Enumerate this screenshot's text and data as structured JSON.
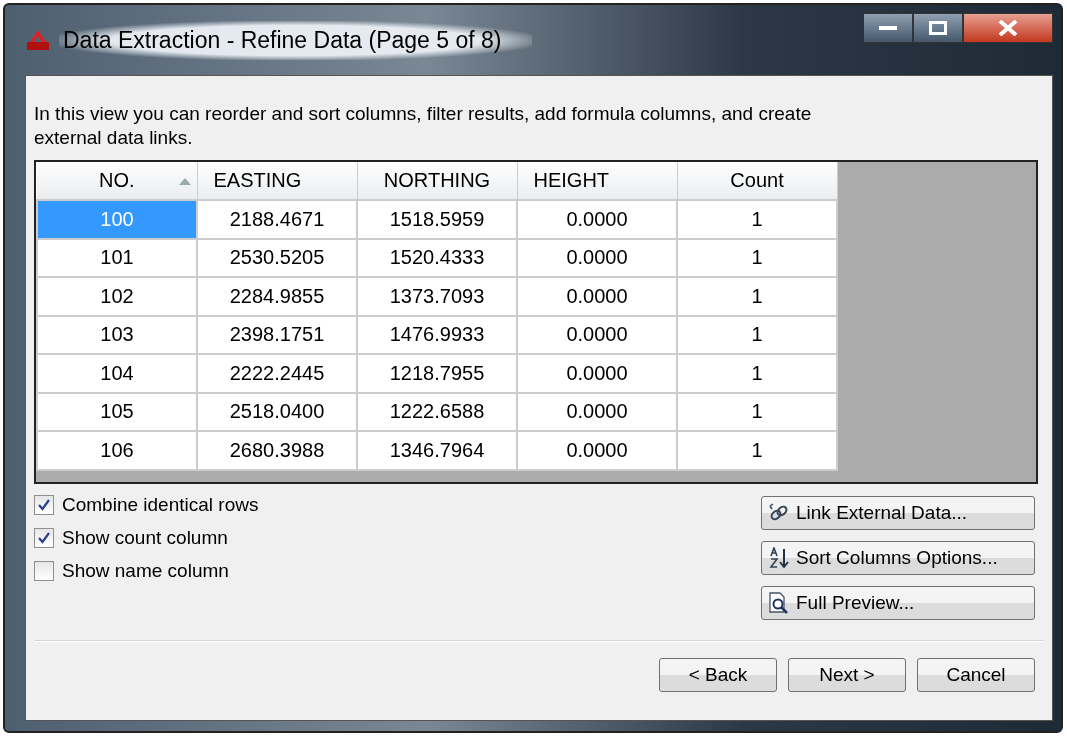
{
  "window": {
    "title": "Data Extraction - Refine Data (Page 5 of 8)"
  },
  "description": "In this view you can reorder and sort columns, filter results, add formula columns, and create external data links.",
  "table": {
    "columns": [
      {
        "label": "NO.",
        "sorted": true
      },
      {
        "label": "EASTING",
        "sorted": false
      },
      {
        "label": "NORTHING",
        "sorted": false
      },
      {
        "label": "HEIGHT",
        "sorted": false
      },
      {
        "label": "Count",
        "sorted": false
      }
    ],
    "rows": [
      {
        "selected": true,
        "cells": [
          "100",
          "2188.4671",
          "1518.5959",
          "0.0000",
          "1"
        ]
      },
      {
        "selected": false,
        "cells": [
          "101",
          "2530.5205",
          "1520.4333",
          "0.0000",
          "1"
        ]
      },
      {
        "selected": false,
        "cells": [
          "102",
          "2284.9855",
          "1373.7093",
          "0.0000",
          "1"
        ]
      },
      {
        "selected": false,
        "cells": [
          "103",
          "2398.1751",
          "1476.9933",
          "0.0000",
          "1"
        ]
      },
      {
        "selected": false,
        "cells": [
          "104",
          "2222.2445",
          "1218.7955",
          "0.0000",
          "1"
        ]
      },
      {
        "selected": false,
        "cells": [
          "105",
          "2518.0400",
          "1222.6588",
          "0.0000",
          "1"
        ]
      },
      {
        "selected": false,
        "cells": [
          "106",
          "2680.3988",
          "1346.7964",
          "0.0000",
          "1"
        ]
      }
    ]
  },
  "options": [
    {
      "label": "Combine identical rows",
      "checked": true
    },
    {
      "label": "Show count column",
      "checked": true
    },
    {
      "label": "Show name column",
      "checked": false
    }
  ],
  "actions": [
    {
      "label": "Link External Data...",
      "kind": "link"
    },
    {
      "label": "Sort Columns Options...",
      "kind": "sort"
    },
    {
      "label": "Full Preview...",
      "kind": "preview"
    }
  ],
  "buttons": [
    "< Back",
    "Next >",
    "Cancel"
  ]
}
